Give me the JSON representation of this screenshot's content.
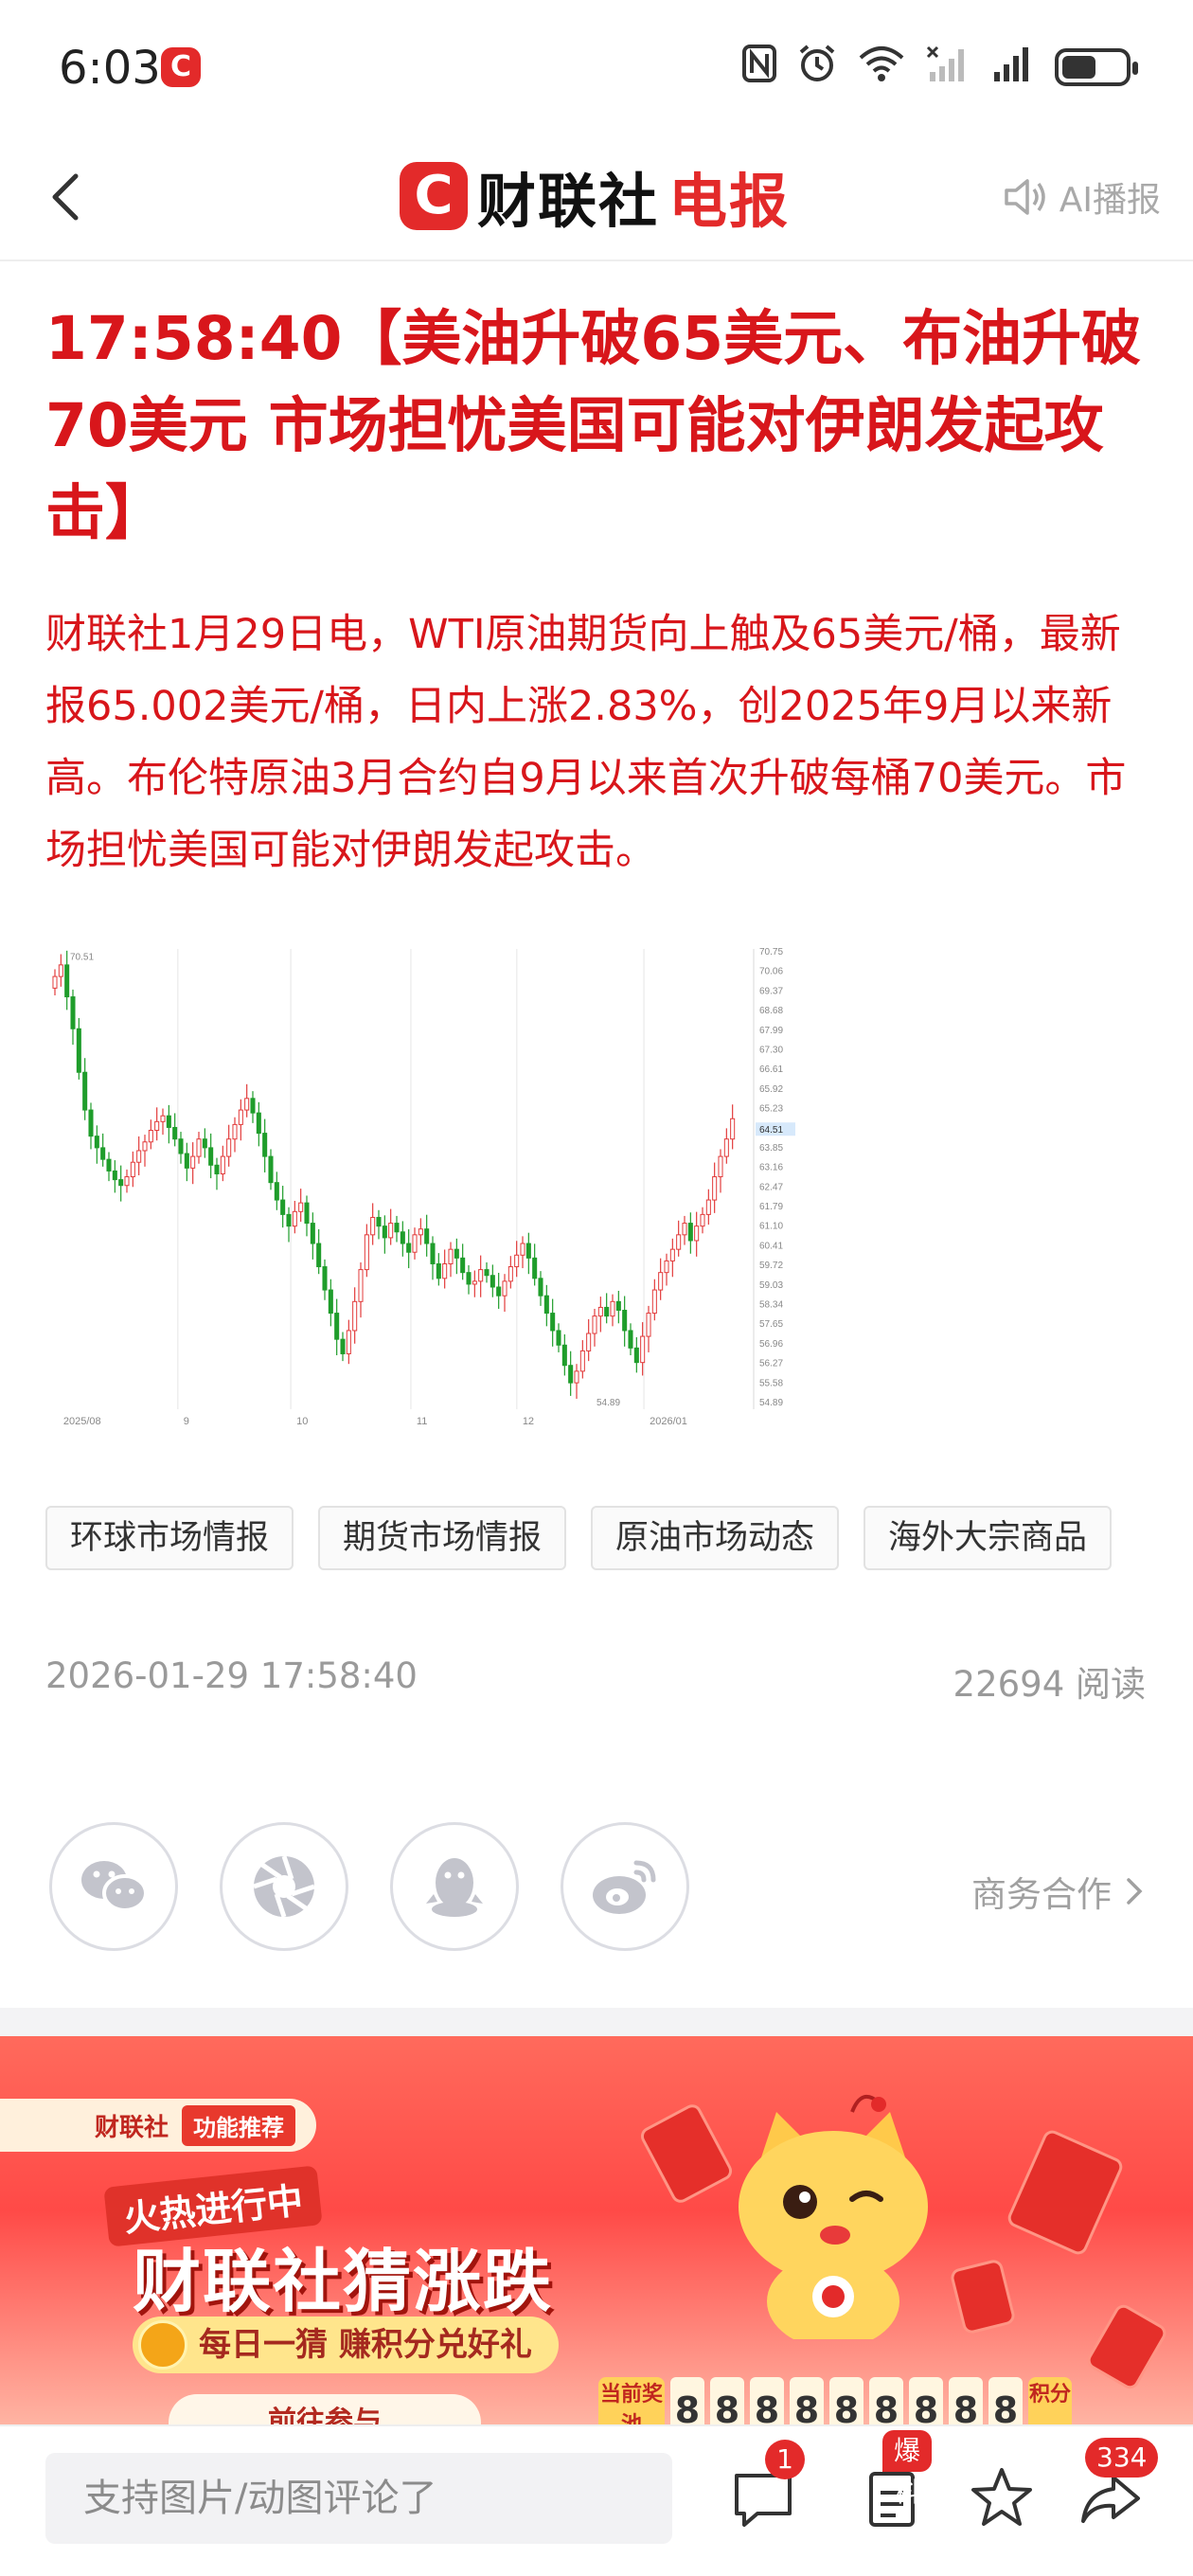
{
  "status_bar": {
    "time": "6:03",
    "app_icon": "C",
    "icons": [
      "nfc-icon",
      "alarm-icon",
      "wifi-icon",
      "signal-off-icon",
      "signal-icon"
    ],
    "battery_level": 0.55
  },
  "header": {
    "logo_mark": "C",
    "logo_brand": "财联社",
    "logo_product": "电报",
    "ai_play_label": "AI播报"
  },
  "article": {
    "headline": "17:58:40【美油升破65美元、布油升破70美元 市场担忧美国可能对伊朗发起攻击】",
    "summary": "财联社1月29日电，WTI原油期货向上触及65美元/桶，最新报65.002美元/桶，日内上涨2.83%，创2025年9月以来新高。布伦特原油3月合约自9月以来首次升破每桶70美元。市场担忧美国可能对伊朗发起攻击。",
    "tags": [
      "环球市场情报",
      "期货市场情报",
      "原油市场动态",
      "海外大宗商品"
    ],
    "date": "2026-01-29 17:58:40",
    "reads": "22694 阅读"
  },
  "chart_data": {
    "type": "candlestick",
    "x_labels": [
      "2025/08",
      "9",
      "10",
      "11",
      "12",
      "2026/01"
    ],
    "y_ticks": [
      "70.75",
      "70.06",
      "69.37",
      "68.68",
      "67.99",
      "67.30",
      "66.61",
      "65.92",
      "65.23",
      "64.54",
      "63.85",
      "63.16",
      "62.47",
      "61.79",
      "61.10",
      "60.41",
      "59.72",
      "59.03",
      "58.34",
      "57.65",
      "56.96",
      "56.27",
      "55.58",
      "54.89"
    ],
    "ylim": [
      54.89,
      70.75
    ],
    "max_label": "70.51",
    "min_label": "54.89",
    "current_label": "64.51",
    "up_color": "#e23b3b",
    "down_color": "#1f9d2b",
    "closes": [
      69.8,
      70.2,
      69.1,
      68.0,
      66.5,
      65.2,
      64.3,
      63.9,
      63.5,
      63.1,
      62.8,
      62.6,
      62.9,
      63.4,
      63.8,
      64.1,
      64.5,
      64.8,
      65.0,
      64.6,
      64.2,
      63.7,
      63.2,
      63.6,
      64.2,
      63.9,
      63.3,
      63.0,
      63.6,
      64.2,
      64.7,
      65.2,
      65.6,
      65.1,
      64.4,
      63.6,
      62.7,
      62.1,
      61.6,
      61.2,
      61.7,
      62.0,
      61.3,
      60.6,
      59.8,
      59.0,
      58.2,
      57.3,
      56.8,
      57.6,
      58.6,
      59.7,
      60.9,
      61.5,
      61.2,
      60.8,
      61.3,
      61.0,
      60.6,
      60.3,
      60.9,
      61.1,
      60.6,
      59.9,
      59.4,
      59.9,
      60.4,
      60.1,
      59.6,
      59.2,
      59.3,
      59.7,
      59.5,
      59.1,
      58.8,
      59.3,
      59.8,
      60.2,
      60.6,
      60.1,
      59.4,
      58.8,
      58.2,
      57.6,
      57.1,
      56.4,
      55.8,
      56.2,
      56.9,
      57.5,
      58.1,
      58.4,
      58.1,
      58.6,
      58.3,
      57.6,
      57.0,
      56.5,
      57.4,
      58.2,
      59.0,
      59.6,
      60.0,
      60.4,
      60.9,
      61.3,
      60.7,
      61.2,
      61.6,
      62.1,
      62.9,
      63.6,
      64.2,
      64.9
    ]
  },
  "share": {
    "icons": [
      "wechat-icon",
      "moments-icon",
      "qq-icon",
      "weibo-icon"
    ],
    "business_label": "商务合作"
  },
  "banner": {
    "chip_brand": "财联社",
    "chip_function": "功能推荐",
    "hot_label": "火热进行中",
    "title": "财联社猜涨跌",
    "subtitle": "每日一猜 赚积分兑好礼",
    "go_label": "前往参与",
    "pool_label": "当前奖池",
    "pool_digits": [
      "8",
      "8",
      "8",
      "8",
      "8",
      "8",
      "8",
      "8",
      "8"
    ],
    "pool_unit": "积分"
  },
  "bottom_bar": {
    "comment_placeholder": "支持图片/动图评论了",
    "comment_count": "1",
    "tip_label": "爆料",
    "share_count": "334"
  }
}
